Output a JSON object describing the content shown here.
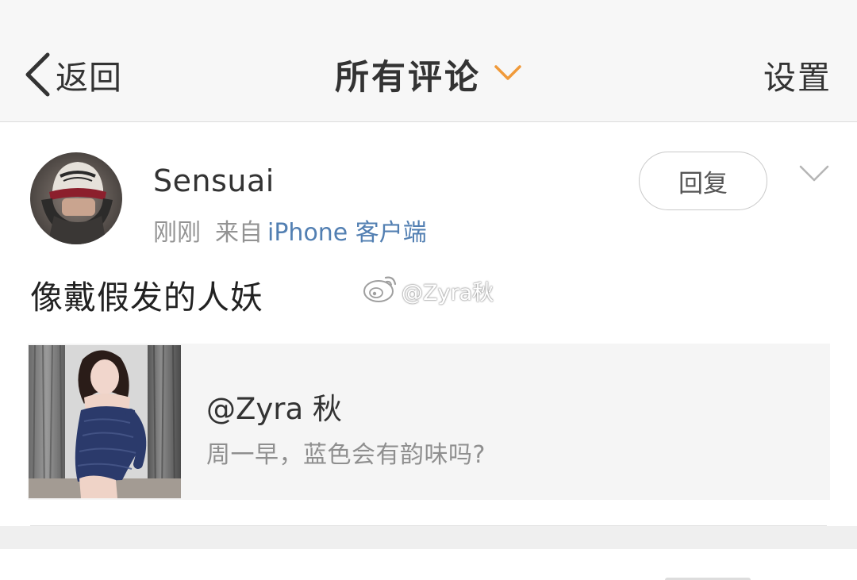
{
  "navbar": {
    "back_label": "返回",
    "title": "所有评论",
    "settings_label": "设置",
    "accent_color": "#f09a3a",
    "back_icon": "chevron-left-icon",
    "title_icon": "chevron-down-icon"
  },
  "comment": {
    "username": "Sensuai",
    "time": "刚刚",
    "source_prefix": "来自",
    "source": "iPhone 客户端",
    "source_color": "#527fb2",
    "reply_label": "回复",
    "more_icon": "chevron-down-icon",
    "avatar_icon": "user-avatar",
    "text": "像戴假发的人妖",
    "watermark": "@Zyra秋",
    "watermark_icon": "weibo-logo-icon"
  },
  "quoted_post": {
    "author": "@Zyra 秋",
    "text": "周一早，蓝色会有韵味吗?",
    "thumbnail_icon": "post-thumbnail"
  }
}
